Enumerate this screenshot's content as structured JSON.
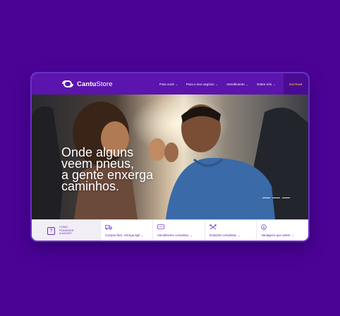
{
  "brand": {
    "logo_text_bold": "Cantu",
    "logo_text_light": "Store",
    "colors": {
      "background": "#4b0396",
      "primary": "#5b14ad",
      "accent": "#ffb347"
    }
  },
  "nav": {
    "items": [
      {
        "label": "Para você"
      },
      {
        "label": "Para o seu negócio"
      },
      {
        "label": "Atendimento"
      },
      {
        "label": "Sobre nós"
      }
    ],
    "login_label": "ENTRAR"
  },
  "hero": {
    "headline": [
      "Onde alguns",
      "veem pneus,",
      "a gente enxerga",
      "caminhos."
    ],
    "slides_count": 3
  },
  "help": {
    "icon": "question-icon",
    "label": "COMO PODEMOS AJUDAR?"
  },
  "features": [
    {
      "icon": "truck-icon",
      "label": "Compra fácil, entrega ágil"
    },
    {
      "icon": "chat-icon",
      "label": "Atendimento consultivo"
    },
    {
      "icon": "tools-icon",
      "label": "Soluções completas"
    },
    {
      "icon": "dollar-icon",
      "label": "Vantagens que valem"
    }
  ]
}
